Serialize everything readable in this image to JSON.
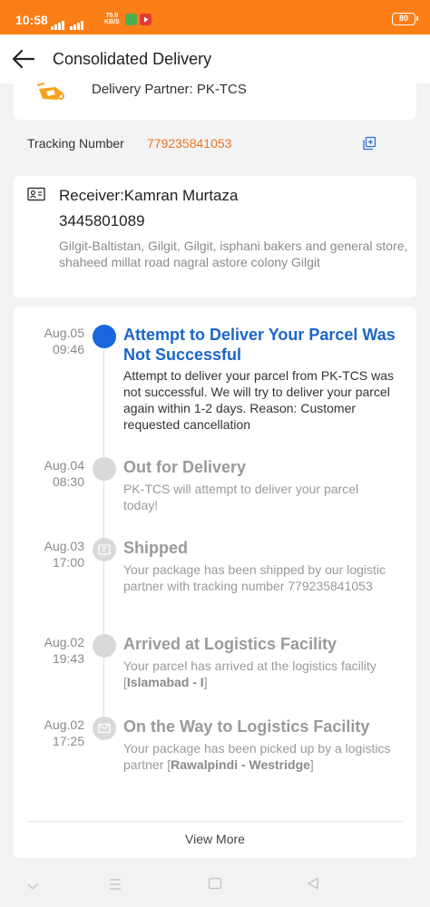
{
  "status_bar": {
    "time": "10:58",
    "net_speed_value": "70.0",
    "net_speed_unit": "KB/S",
    "battery": "80"
  },
  "header": {
    "title": "Consolidated Delivery",
    "back_icon": "arrow-left-icon"
  },
  "partner": {
    "label": "Delivery Partner: PK-TCS"
  },
  "tracking": {
    "label": "Tracking Number",
    "number": "779235841053",
    "copy_icon": "copy-icon"
  },
  "receiver": {
    "name": "Receiver:Kamran Murtaza",
    "phone": "3445801089",
    "address": "Gilgit-Baltistan, Gilgit, Gilgit, isphani bakers and general store, shaheed millat road nagral astore colony Gilgit"
  },
  "timeline": [
    {
      "date": "Aug.05",
      "time": "09:46",
      "title": "Attempt to Deliver Your Parcel Was Not Successful",
      "desc": "Attempt to deliver your parcel from PK-TCS was not successful. We will try to deliver your parcel again within 1-2 days. Reason: Customer requested cancellation",
      "active": true
    },
    {
      "date": "Aug.04",
      "time": "08:30",
      "title": "Out for Delivery",
      "desc": "PK-TCS will attempt to deliver your parcel today!"
    },
    {
      "date": "Aug.03",
      "time": "17:00",
      "title": "Shipped",
      "desc": "Your package has been shipped by our logistic partner with tracking number 779235841053"
    },
    {
      "date": "Aug.02",
      "time": "19:43",
      "title": "Arrived at Logistics Facility",
      "desc_prefix": "Your parcel has arrived at the logistics facility [",
      "desc_bold": "Islamabad - I",
      "desc_suffix": "]"
    },
    {
      "date": "Aug.02",
      "time": "17:25",
      "title": "On the Way to Logistics Facility",
      "desc_prefix": "Your package has been picked up by a logistics partner [",
      "desc_bold": "Rawalpindi - Westridge",
      "desc_suffix": "]"
    }
  ],
  "view_more": "View More",
  "colors": {
    "brand_orange": "#fb7d16",
    "tracking_orange": "#f0731f",
    "active_blue": "#1a66e0"
  }
}
